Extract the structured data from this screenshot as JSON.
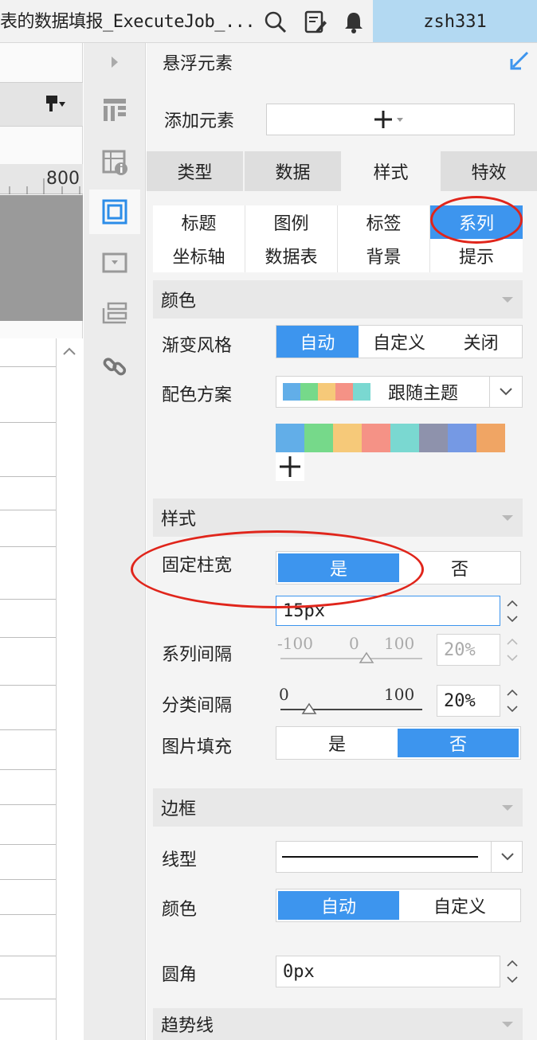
{
  "topbar": {
    "title": "表的数据填报_ExecuteJob_...",
    "user": "zsh331",
    "icons": [
      "search-icon",
      "edit-icon",
      "bell-icon"
    ]
  },
  "canvas": {
    "ruler_label": "800"
  },
  "rail": {
    "icons": [
      "expand-arrow-icon",
      "layout-icon",
      "table-info-icon",
      "frame-icon",
      "widget-icon",
      "list-icon",
      "link-icon"
    ],
    "active": "frame-icon"
  },
  "panel": {
    "title": "悬浮元素",
    "add_label": "添加元素",
    "tabs": [
      {
        "label": "类型"
      },
      {
        "label": "数据"
      },
      {
        "label": "样式",
        "active": true
      },
      {
        "label": "特效"
      }
    ],
    "sub_tabs": [
      {
        "label": "标题"
      },
      {
        "label": "图例"
      },
      {
        "label": "标签"
      },
      {
        "label": "系列",
        "active": true
      },
      {
        "label": "坐标轴"
      },
      {
        "label": "数据表"
      },
      {
        "label": "背景"
      },
      {
        "label": "提示"
      }
    ],
    "color_section": {
      "header": "颜色",
      "gradient_label": "渐变风格",
      "gradient_options": [
        "自动",
        "自定义",
        "关闭"
      ],
      "gradient_selected": "自动",
      "scheme_label": "配色方案",
      "scheme_value": "跟随主题",
      "scheme_mini_colors": [
        "#62aee8",
        "#76d98a",
        "#f6c979",
        "#f59286",
        "#7ad8d1"
      ],
      "palette": [
        "#62aee8",
        "#76d98a",
        "#f6c979",
        "#f59286",
        "#7ad8d1",
        "#8e92ac",
        "#7599e4",
        "#f0a564"
      ]
    },
    "style_section": {
      "header": "样式",
      "fixed_width_label": "固定柱宽",
      "fixed_width_options": [
        "是",
        "否"
      ],
      "fixed_width_selected": "是",
      "bar_width_value": "15px",
      "series_gap_label": "系列间隔",
      "series_gap_min": "-100",
      "series_gap_mid": "0",
      "series_gap_max": "100",
      "series_gap_value": "20%",
      "category_gap_label": "分类间隔",
      "category_gap_min": "0",
      "category_gap_max": "100",
      "category_gap_value": "20%",
      "image_fill_label": "图片填充",
      "image_fill_options": [
        "是",
        "否"
      ],
      "image_fill_selected": "否"
    },
    "border_section": {
      "header": "边框",
      "line_type_label": "线型",
      "color_label": "颜色",
      "color_options": [
        "自动",
        "自定义"
      ],
      "color_selected": "自动",
      "radius_label": "圆角",
      "radius_value": "0px"
    },
    "trend_section": {
      "header": "趋势线"
    }
  },
  "colors": {
    "accent": "#3d95ee",
    "user_bg": "#b3d9f2",
    "annotation": "#e0251b"
  }
}
